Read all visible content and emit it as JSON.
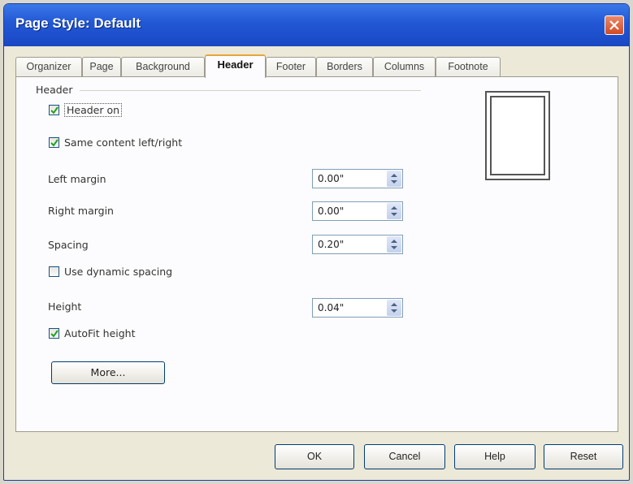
{
  "window": {
    "title": "Page Style: Default"
  },
  "tabs": [
    {
      "label": "Organizer"
    },
    {
      "label": "Page"
    },
    {
      "label": "Background"
    },
    {
      "label": "Header"
    },
    {
      "label": "Footer"
    },
    {
      "label": "Borders"
    },
    {
      "label": "Columns"
    },
    {
      "label": "Footnote"
    }
  ],
  "header_group": {
    "label": "Header",
    "header_on": {
      "label": "Header on",
      "checked": true
    },
    "same_content": {
      "label": "Same content left/right",
      "checked": true
    },
    "left_margin": {
      "label": "Left margin",
      "value": "0.00\""
    },
    "right_margin": {
      "label": "Right margin",
      "value": "0.00\""
    },
    "spacing": {
      "label": "Spacing",
      "value": "0.20\""
    },
    "dynamic_spacing": {
      "label": "Use dynamic spacing",
      "checked": false
    },
    "height": {
      "label": "Height",
      "value": "0.04\""
    },
    "autofit": {
      "label": "AutoFit height",
      "checked": true
    },
    "more_button": "More..."
  },
  "buttons": {
    "ok": "OK",
    "cancel": "Cancel",
    "help": "Help",
    "reset": "Reset"
  },
  "colors": {
    "title_bar": "#2257d4",
    "active_tab_accent": "#e5a53a",
    "dialog_bg": "#ece9d8"
  }
}
